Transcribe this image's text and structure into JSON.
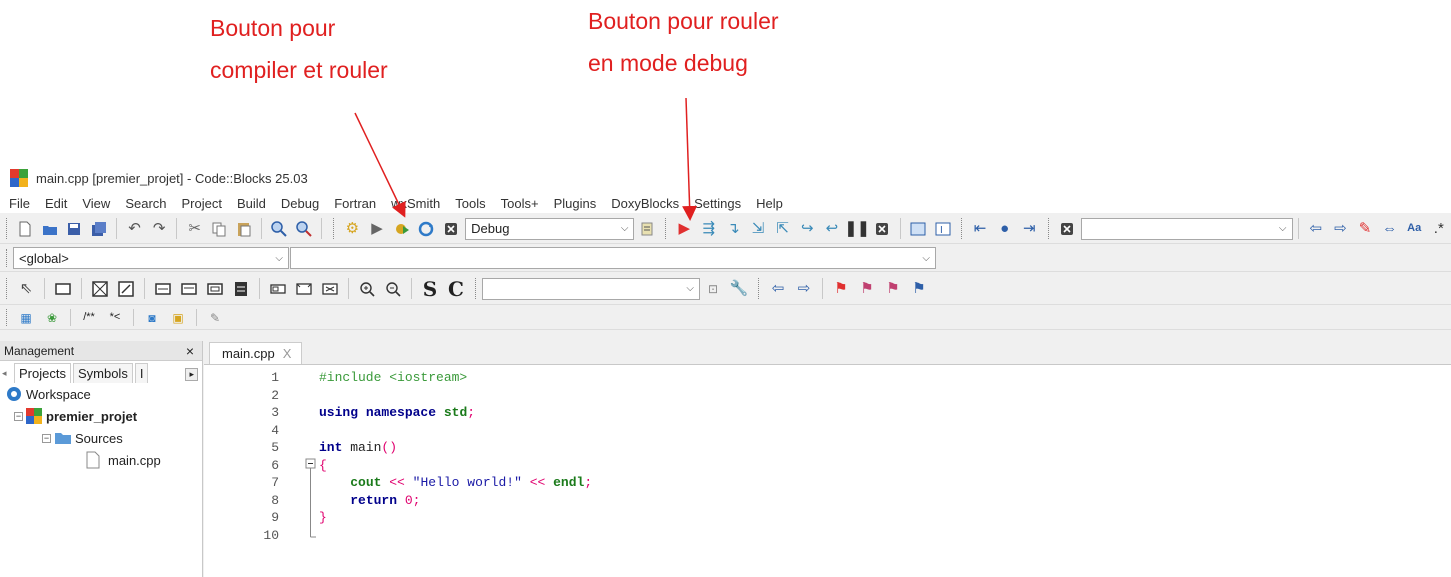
{
  "annotations": {
    "compile_run": [
      "Bouton pour",
      "compiler et rouler"
    ],
    "debug_run": [
      "Bouton pour rouler",
      "en mode debug"
    ]
  },
  "window": {
    "title": "main.cpp [premier_projet] - Code::Blocks 25.03"
  },
  "menu": [
    "File",
    "Edit",
    "View",
    "Search",
    "Project",
    "Build",
    "Debug",
    "Fortran",
    "wxSmith",
    "Tools",
    "Tools+",
    "Plugins",
    "DoxyBlocks",
    "Settings",
    "Help"
  ],
  "toolbar": {
    "build_target": "Debug",
    "scope_select": "<global>",
    "symbol_select": "",
    "search_combo": "",
    "jump_combo": ""
  },
  "management": {
    "title": "Management",
    "close": "×",
    "tabs": [
      "Projects",
      "Symbols",
      "I"
    ],
    "tree": {
      "workspace": "Workspace",
      "project": "premier_projet",
      "folder": "Sources",
      "file": "main.cpp"
    }
  },
  "editor": {
    "tab_label": "main.cpp",
    "tab_close": "X",
    "line_numbers": [
      "1",
      "2",
      "3",
      "4",
      "5",
      "6",
      "7",
      "8",
      "9",
      "10"
    ]
  },
  "colors": {
    "annotation": "#e02020",
    "run_green": "#3a9a3a",
    "debug_red": "#e03030"
  }
}
